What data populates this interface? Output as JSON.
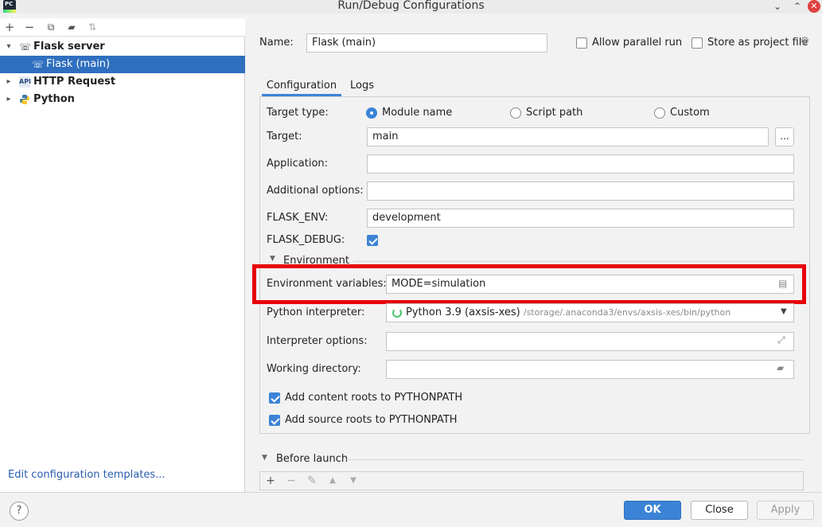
{
  "window": {
    "title": "Run/Debug Configurations",
    "app_icon_text": "PC"
  },
  "left": {
    "toolbar": [
      "add-icon",
      "remove-icon",
      "copy-icon",
      "folder-icon",
      "sort-icon"
    ],
    "tree": [
      {
        "label": "Flask server",
        "expanded": true,
        "bold": true
      },
      {
        "label": "Flask (main)",
        "selected": true
      },
      {
        "label": "HTTP Request",
        "bold": true
      },
      {
        "label": "Python",
        "bold": true
      }
    ],
    "edit_templates": "Edit configuration templates..."
  },
  "header": {
    "name_label": "Name:",
    "name_value": "Flask (main)",
    "allow_parallel": "Allow parallel run",
    "store_project": "Store as project file"
  },
  "tabs": [
    "Configuration",
    "Logs"
  ],
  "config": {
    "target_type_label": "Target type:",
    "target_type_options": [
      "Module name",
      "Script path",
      "Custom"
    ],
    "target_label": "Target:",
    "target_value": "main",
    "ellipsis": "...",
    "application_label": "Application:",
    "additional_options_label": "Additional options:",
    "flask_env_label": "FLASK_ENV:",
    "flask_env_value": "development",
    "flask_debug_label": "FLASK_DEBUG:",
    "environment_section": "Environment",
    "env_vars_label": "Environment variables:",
    "env_vars_value": "MODE=simulation",
    "interpreter_label": "Python interpreter:",
    "interpreter_name": "Python 3.9 (axsis-xes)",
    "interpreter_path": "/storage/.anaconda3/envs/axsis-xes/bin/python",
    "interpreter_options_label": "Interpreter options:",
    "working_dir_label": "Working directory:",
    "add_content_roots": "Add content roots to PYTHONPATH",
    "add_source_roots": "Add source roots to PYTHONPATH"
  },
  "before_launch": "Before launch",
  "buttons": {
    "ok": "OK",
    "close": "Close",
    "apply": "Apply",
    "help": "?"
  },
  "colors": {
    "accent": "#3b83d6",
    "selection": "#2f6fbf",
    "highlight": "#e8000b"
  }
}
